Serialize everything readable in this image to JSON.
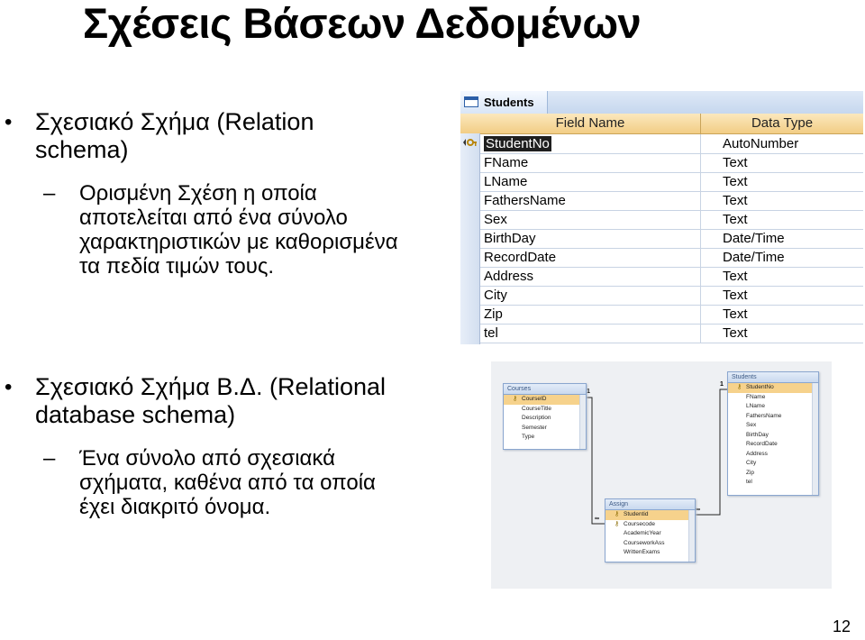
{
  "slide": {
    "title": "Σχέσεις Βάσεων Δεδομένων",
    "bullet1": "Σχεσιακό Σχήμα (Relation schema)",
    "sub1": "Ορισμένη Σχέση η οποία αποτελείται από ένα σύνολο χαρακτηριστικών με καθορισμένα τα πεδία τιμών τους.",
    "bullet2": "Σχεσιακό Σχήμα Β.Δ. (Relational database schema)",
    "sub2": "Ένα σύνολο από σχεσιακά σχήματα, καθένα από τα οποία έχει διακριτό όνομα.",
    "page_number": "12"
  },
  "design_view": {
    "tab_label": "Students",
    "col_field": "Field Name",
    "col_type": "Data Type",
    "rows": [
      {
        "field": "StudentNo",
        "type": "AutoNumber"
      },
      {
        "field": "FName",
        "type": "Text"
      },
      {
        "field": "LName",
        "type": "Text"
      },
      {
        "field": "FathersName",
        "type": "Text"
      },
      {
        "field": "Sex",
        "type": "Text"
      },
      {
        "field": "BirthDay",
        "type": "Date/Time"
      },
      {
        "field": "RecordDate",
        "type": "Date/Time"
      },
      {
        "field": "Address",
        "type": "Text"
      },
      {
        "field": "City",
        "type": "Text"
      },
      {
        "field": "Zip",
        "type": "Text"
      },
      {
        "field": "tel",
        "type": "Text"
      }
    ]
  },
  "relationships": {
    "courses": {
      "title": "Courses",
      "fields": [
        "CourseID",
        "CourseTitle",
        "Description",
        "Semester",
        "Type"
      ]
    },
    "students": {
      "title": "Students",
      "fields": [
        "StudentNo",
        "FName",
        "LName",
        "FathersName",
        "Sex",
        "BirthDay",
        "RecordDate",
        "Address",
        "City",
        "Zip",
        "tel"
      ]
    },
    "assign": {
      "title": "Assign",
      "fields": [
        "Studentid",
        "Coursecode",
        "AcademicYear",
        "CourseworkAss",
        "WrittenExams"
      ]
    },
    "one_label": "1",
    "many_label": "∞"
  }
}
